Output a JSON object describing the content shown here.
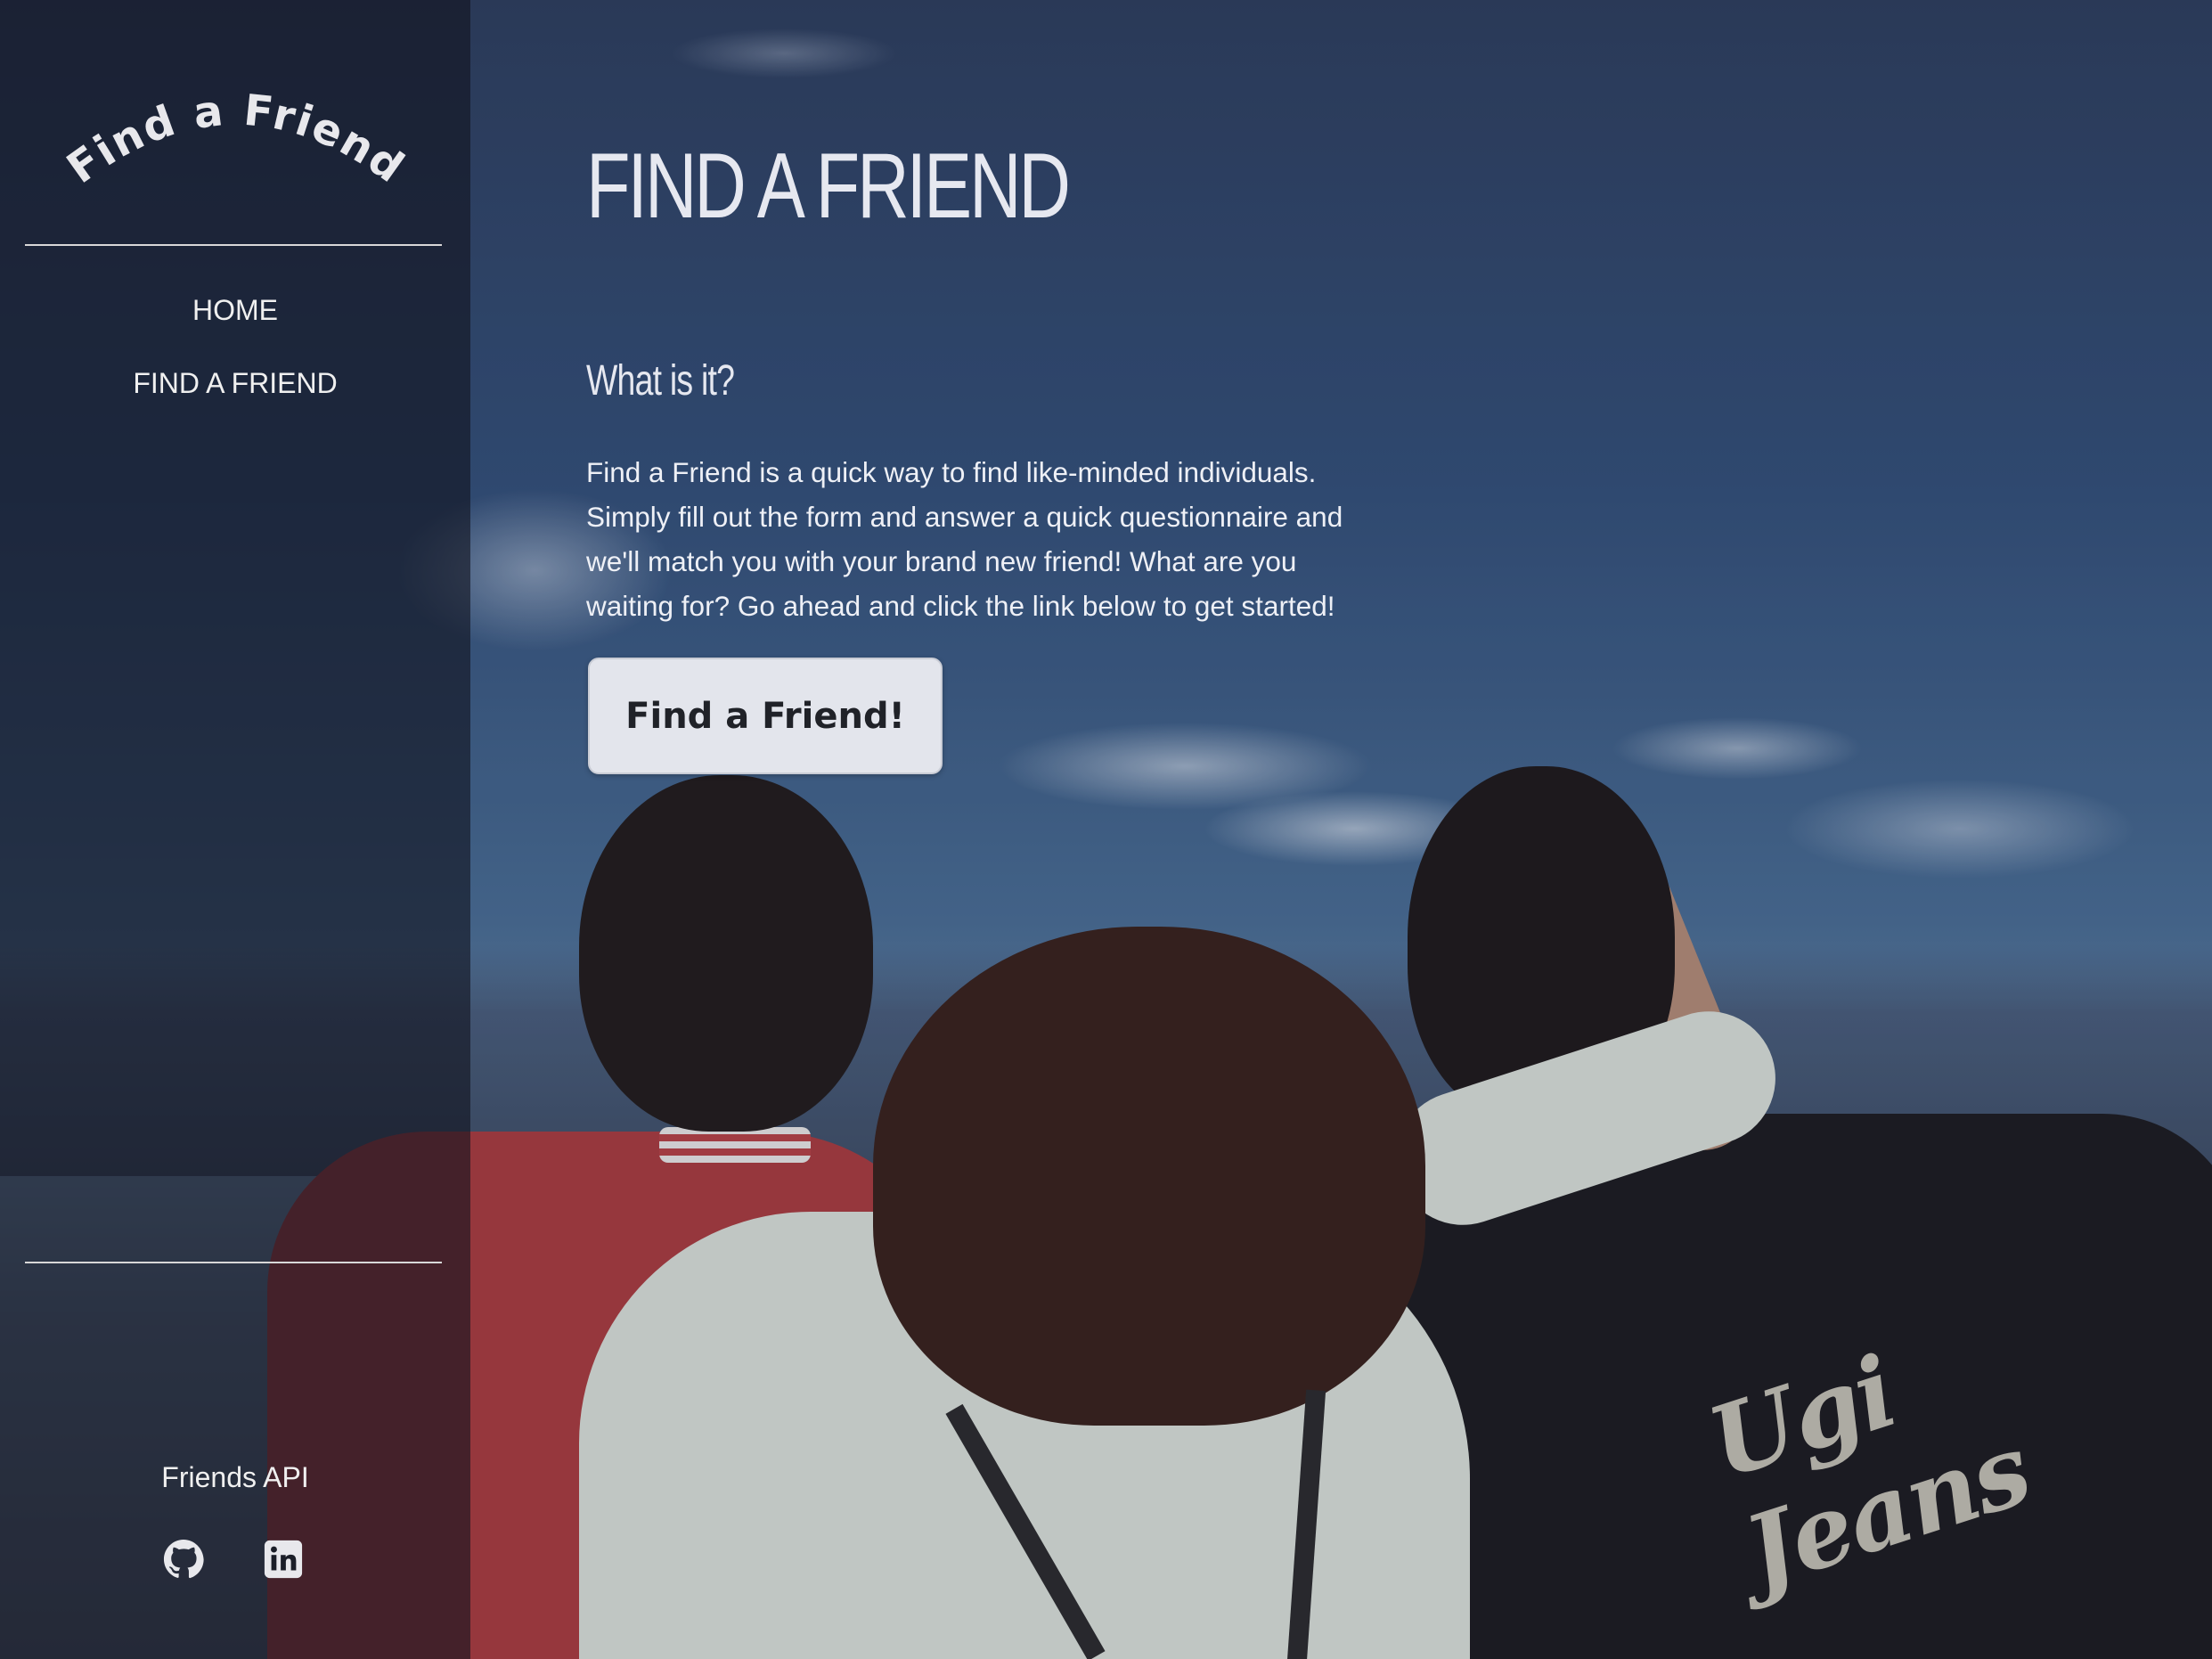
{
  "sidebar": {
    "logo_text": "- Find a Friend -",
    "nav": [
      {
        "label": "HOME"
      },
      {
        "label": "FIND A FRIEND"
      }
    ],
    "footer_label": "Friends API",
    "social": [
      {
        "icon": "github-icon"
      },
      {
        "icon": "linkedin-icon"
      }
    ]
  },
  "main": {
    "title": "FIND A FRIEND",
    "subtitle": "What is it?",
    "description": "Find a Friend is a quick way to find like-minded individuals. Simply fill out the form and answer a quick questionnaire and we'll match you with your brand new friend! What are you waiting for? Go ahead and click the link below to get started!",
    "cta_label": "Find a Friend!"
  },
  "background": {
    "jacket_text": "Ugi Jeans"
  },
  "colors": {
    "sidebar_overlay": "#11141e",
    "text_light": "#e6e8f0",
    "button_bg": "#e3e5ec",
    "button_text": "#202228"
  }
}
